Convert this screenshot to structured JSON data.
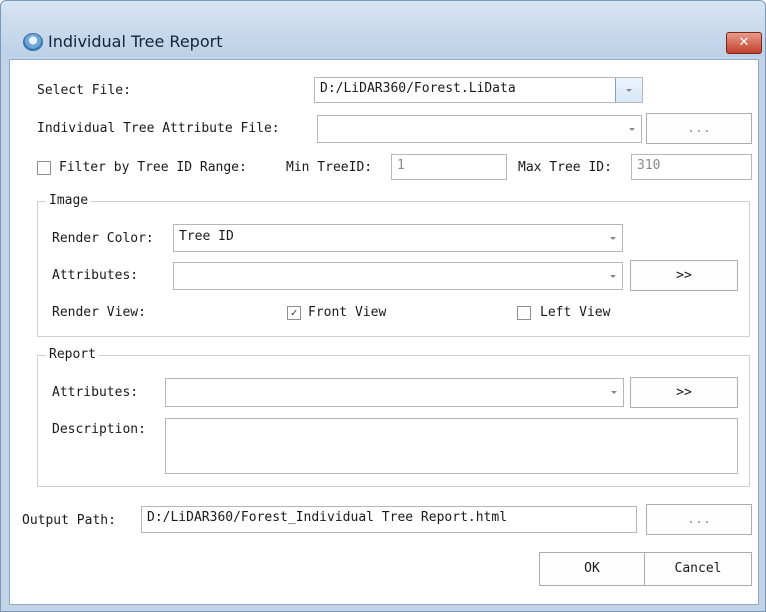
{
  "window": {
    "title": "Individual Tree Report",
    "close_glyph": "✕"
  },
  "select_file": {
    "label": "Select File:",
    "value": "D:/LiDAR360/Forest.LiData"
  },
  "attr_file": {
    "label": "Individual Tree Attribute File:",
    "value": "",
    "browse_label": "..."
  },
  "filter": {
    "label": "Filter by Tree ID Range:",
    "checked": false,
    "min_label": "Min TreeID:",
    "min_value": "1",
    "max_label": "Max Tree ID:",
    "max_value": "310"
  },
  "image": {
    "title": "Image",
    "render_color_label": "Render Color:",
    "render_color_value": "Tree ID",
    "attributes_label": "Attributes:",
    "attributes_value": "",
    "attributes_button": ">>",
    "render_view_label": "Render View:",
    "front_view": {
      "label": "Front View",
      "checked": true
    },
    "left_view": {
      "label": "Left View",
      "checked": false
    }
  },
  "report": {
    "title": "Report",
    "attributes_label": "Attributes:",
    "attributes_value": "",
    "attributes_button": ">>",
    "description_label": "Description:",
    "description_value": ""
  },
  "output": {
    "label": "Output Path:",
    "value": "D:/LiDAR360/Forest_Individual Tree Report.html",
    "browse_label": "..."
  },
  "buttons": {
    "ok": "OK",
    "cancel": "Cancel"
  },
  "icons": {
    "app": "app-logo-icon",
    "check": "✓"
  }
}
